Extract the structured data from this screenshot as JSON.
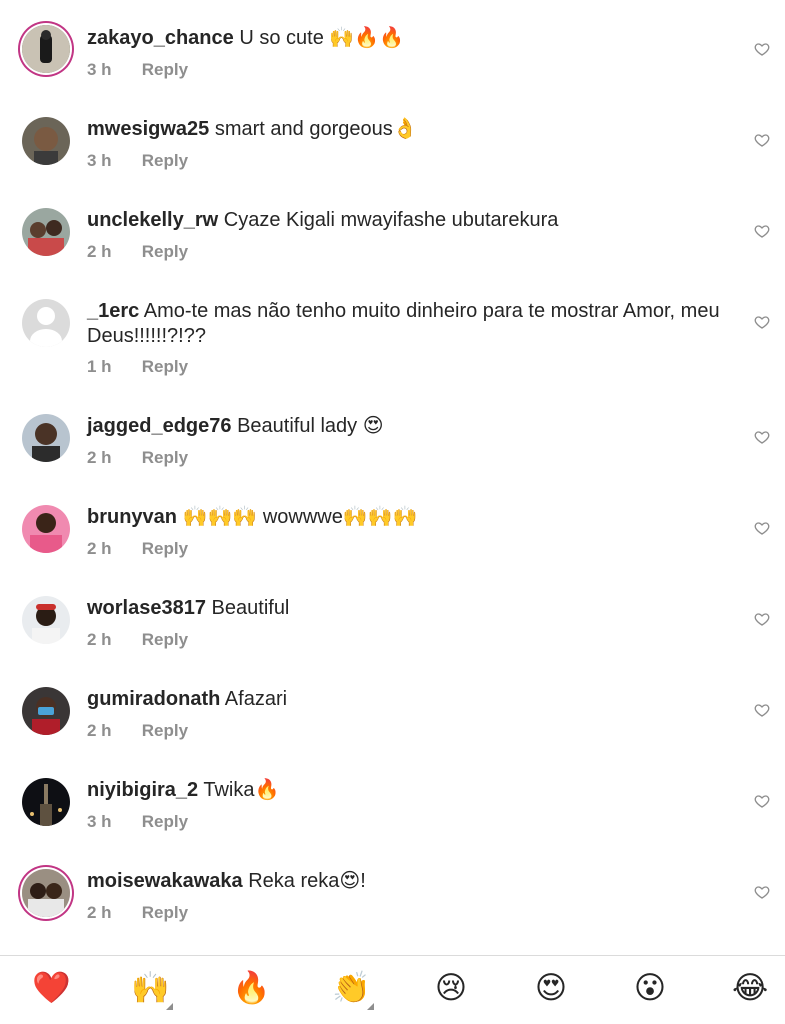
{
  "comments": [
    {
      "username": "zakayo_chance",
      "text": "U so cute 🙌🔥🔥",
      "time": "3 h",
      "reply": "Reply",
      "story_ring": true
    },
    {
      "username": "mwesigwa25",
      "text": "smart and gorgeous👌",
      "time": "3 h",
      "reply": "Reply",
      "story_ring": false
    },
    {
      "username": "unclekelly_rw",
      "text": "Cyaze Kigali  mwayifashe ubutarekura",
      "time": "2 h",
      "reply": "Reply",
      "story_ring": false
    },
    {
      "username": "_1erc",
      "text": "Amo-te mas não tenho muito dinheiro para te mostrar Amor, meu Deus!!!!!!?!??",
      "time": "1 h",
      "reply": "Reply",
      "story_ring": false
    },
    {
      "username": "jagged_edge76",
      "text": "Beautiful lady 😍",
      "time": "2 h",
      "reply": "Reply",
      "story_ring": false
    },
    {
      "username": "brunyvan",
      "text": "🙌🙌🙌 wowwwe🙌🙌🙌",
      "time": "2 h",
      "reply": "Reply",
      "story_ring": false
    },
    {
      "username": "worlase3817",
      "text": "Beautiful",
      "time": "2 h",
      "reply": "Reply",
      "story_ring": false
    },
    {
      "username": "gumiradonath",
      "text": "Afazari",
      "time": "2 h",
      "reply": "Reply",
      "story_ring": false
    },
    {
      "username": "niyibigira_2",
      "text": "Twika🔥",
      "time": "3 h",
      "reply": "Reply",
      "story_ring": false
    },
    {
      "username": "moisewakawaka",
      "text": "Reka reka😍!",
      "time": "2 h",
      "reply": "Reply",
      "story_ring": true
    }
  ],
  "reactions": [
    "❤️",
    "🙌",
    "🔥",
    "👏",
    "😢",
    "😍",
    "😮",
    "😂"
  ],
  "colors": {
    "accent_ring": "#c13584",
    "secondary_text": "#8e8e8e",
    "heart_outline": "#8e8e8e"
  }
}
